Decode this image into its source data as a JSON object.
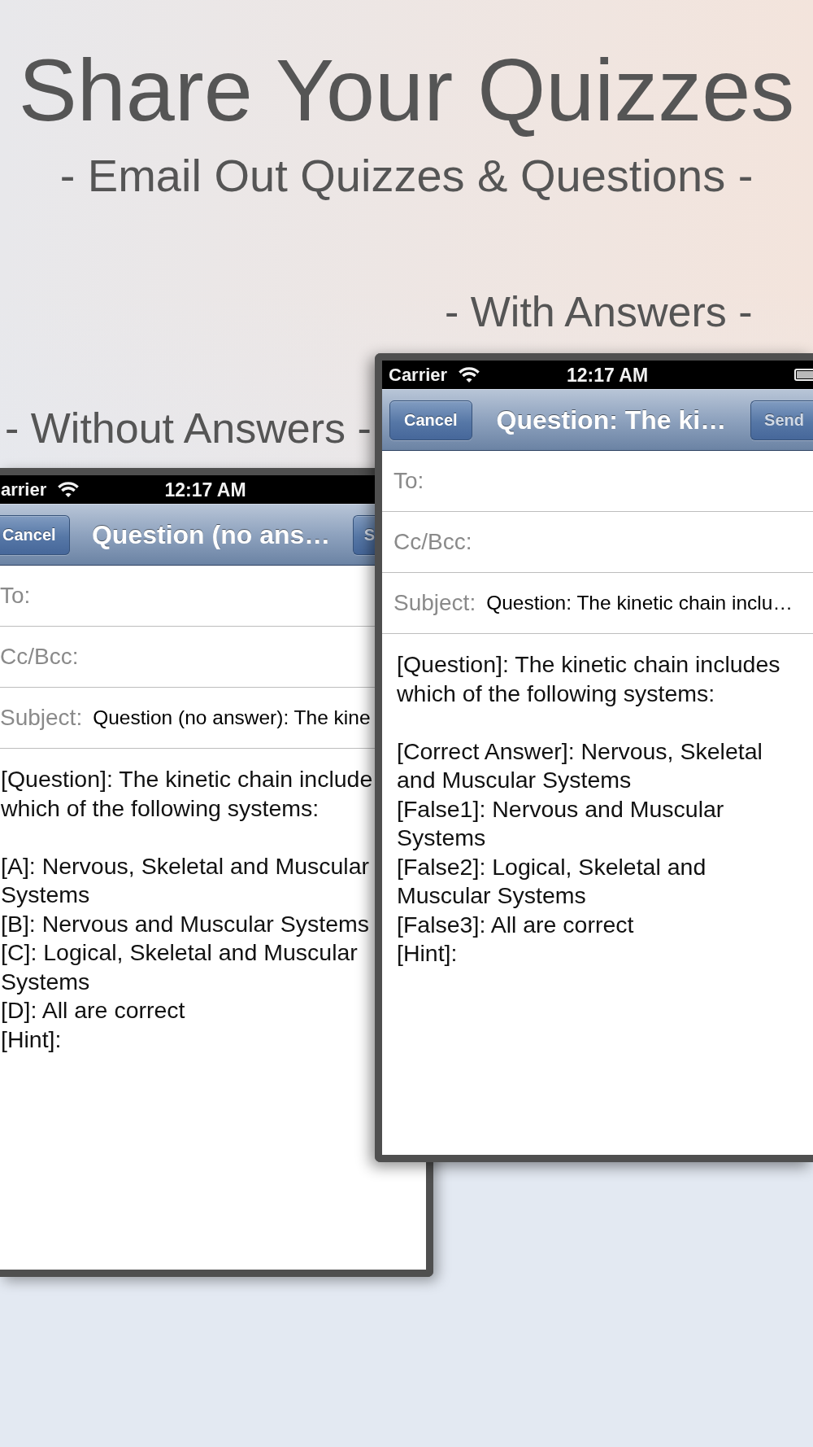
{
  "headline": {
    "title": "Share Your Quizzes",
    "subtitle": "- Email Out Quizzes & Questions -"
  },
  "screens": [
    {
      "caption": "- With Answers -",
      "status_bar": {
        "carrier": "Carrier",
        "time": "12:17 AM",
        "battery_visible": true
      },
      "nav_bar": {
        "cancel_button": "Cancel",
        "title": "Question: The ki…",
        "send_button": {
          "label": "Send",
          "disabled": true
        }
      },
      "fields": [
        {
          "label": "To:"
        },
        {
          "label": "Cc/Bcc:"
        },
        {
          "label": "Subject:",
          "value": "Question: The kinetic chain inclu…"
        }
      ],
      "body": {
        "question": [
          "[Question]: The kinetic chain includes",
          "which of the following systems:"
        ],
        "answers": [
          [
            "[Correct Answer]: Nervous, Skeletal",
            "and Muscular Systems"
          ],
          [
            "[False1]: Nervous and Muscular",
            "Systems"
          ],
          [
            "[False2]: Logical, Skeletal and",
            "Muscular Systems"
          ],
          [
            "[False3]: All are correct"
          ],
          [
            "[Hint]:"
          ]
        ]
      }
    },
    {
      "caption": "- Without Answers -",
      "status_bar": {
        "carrier": "arrier",
        "time": "12:17 AM",
        "battery_visible": false
      },
      "nav_bar": {
        "cancel_button": "Cancel",
        "title": "Question (no ans…",
        "send_button": {
          "label": "S",
          "disabled": true
        }
      },
      "fields": [
        {
          "label": "To:"
        },
        {
          "label": "Cc/Bcc:"
        },
        {
          "label": "Subject:",
          "value": "Question (no answer): The kine"
        }
      ],
      "body": {
        "question": [
          "[Question]: The kinetic chain include",
          "which of the following systems:"
        ],
        "answers": [
          [
            "[A]: Nervous, Skeletal and Muscular",
            "Systems"
          ],
          [
            "[B]: Nervous and Muscular Systems"
          ],
          [
            "[C]: Logical, Skeletal and Muscular",
            "Systems"
          ],
          [
            "[D]: All are correct"
          ],
          [
            "[Hint]:"
          ]
        ]
      }
    }
  ]
}
